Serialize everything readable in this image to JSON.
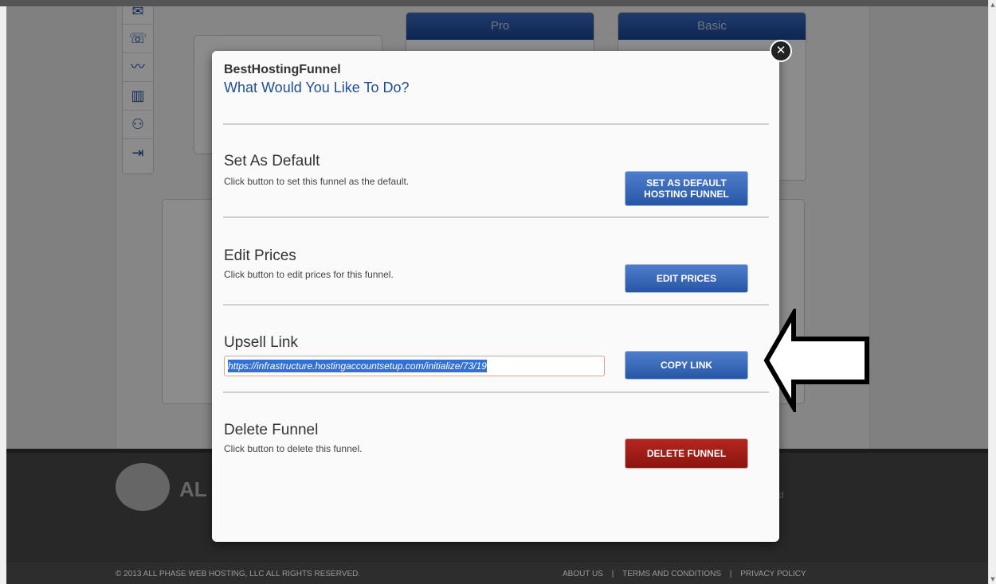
{
  "plans": {
    "pro": "Pro",
    "basic": "Basic"
  },
  "sidebar_icons": [
    {
      "name": "mail-icon",
      "glyph": "✉"
    },
    {
      "name": "phone-icon",
      "glyph": "☏"
    },
    {
      "name": "trend-icon",
      "glyph": "〰"
    },
    {
      "name": "bar-chart-icon",
      "glyph": "▥"
    },
    {
      "name": "users-icon",
      "glyph": "⚇"
    },
    {
      "name": "logout-icon",
      "glyph": "⇥"
    }
  ],
  "modal": {
    "title": "BestHostingFunnel",
    "subtitle": "What Would You Like To Do?",
    "sections": {
      "default": {
        "title": "Set As Default",
        "desc": "Click button to set this funnel as the default.",
        "button_line1": "SET AS DEFAULT",
        "button_line2": "HOSTING FUNNEL"
      },
      "prices": {
        "title": "Edit Prices",
        "desc": "Click button to edit prices for this funnel.",
        "button": "EDIT PRICES"
      },
      "upsell": {
        "title": "Upsell Link",
        "link_value": "https://infrastructure.hostingaccountsetup.com/initialize/73/19",
        "button": "COPY LINK"
      },
      "delete": {
        "title": "Delete Funnel",
        "desc": "Click button to delete this funnel.",
        "button": "DELETE FUNNEL"
      }
    }
  },
  "footer": {
    "logo_text": "AL",
    "right_fragment": "d",
    "copyright": "© 2013 ALL PHASE WEB HOSTING, LLC ALL RIGHTS RESERVED.",
    "links": [
      "ABOUT US",
      "TERMS AND CONDITIONS",
      "PRIVACY POLICY"
    ],
    "separator": "|"
  },
  "colors": {
    "accent_blue": "#2756a6",
    "danger_red": "#a31c16",
    "subtitle_blue": "#1f4c97"
  }
}
